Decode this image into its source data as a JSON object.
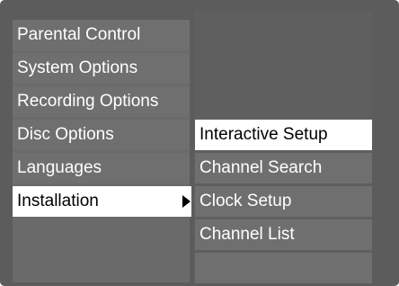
{
  "main_menu": {
    "items": [
      {
        "label": "Parental Control"
      },
      {
        "label": "System Options"
      },
      {
        "label": "Recording Options"
      },
      {
        "label": "Disc Options"
      },
      {
        "label": "Languages"
      },
      {
        "label": "Installation",
        "selected": true,
        "has_submenu": true
      }
    ]
  },
  "submenu": {
    "items": [
      {
        "label": "Interactive Setup",
        "highlighted": true
      },
      {
        "label": "Channel Search"
      },
      {
        "label": "Clock Setup"
      },
      {
        "label": "Channel List"
      },
      {
        "label": ""
      }
    ]
  },
  "colors": {
    "background": "#5c5c5c",
    "item_background": "#6f6f6f",
    "selected_background": "#ffffff",
    "text": "#ffffff",
    "selected_text": "#000000"
  }
}
